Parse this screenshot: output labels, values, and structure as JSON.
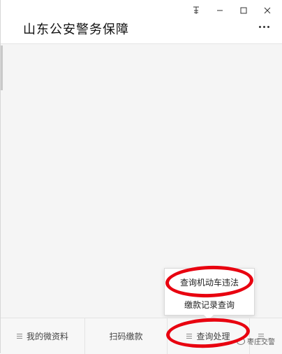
{
  "window": {
    "title": "山东公安警务保障",
    "controls": {
      "pin": "pin-icon",
      "minimize": "minimize-icon",
      "maximize": "maximize-icon",
      "close": "close-icon"
    }
  },
  "popup": {
    "items": [
      {
        "label": "查询机动车违法"
      },
      {
        "label": "缴款记录查询"
      }
    ]
  },
  "bottom_nav": {
    "tabs": [
      {
        "label": "我的微资料"
      },
      {
        "label": "扫码缴款"
      },
      {
        "label": "查询处理"
      }
    ]
  },
  "watermark": {
    "text": "枣庄交警"
  },
  "colors": {
    "annotation": "#e8000f",
    "content_bg": "#f5f5f5"
  }
}
